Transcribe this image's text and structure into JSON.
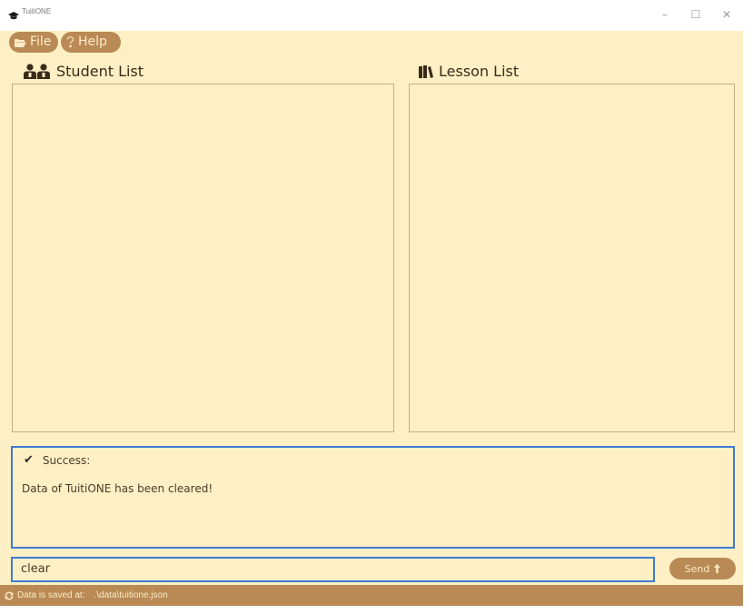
{
  "window": {
    "title": "TuitiONE",
    "controls": {
      "minimize": "–",
      "maximize": "☐",
      "close": "✕"
    }
  },
  "menu": {
    "file_label": "File",
    "help_label": "Help"
  },
  "panels": {
    "student_title": "Student List",
    "lesson_title": "Lesson List"
  },
  "result": {
    "status": "Success:",
    "message": "Data of TuitiONE has been cleared!"
  },
  "command": {
    "value": "clear",
    "send_label": "Send"
  },
  "status_bar": {
    "label": "Data is saved at:",
    "path": ".\\data\\tuitione.json"
  },
  "colors": {
    "background": "#fef0c4",
    "accent": "#b98a55",
    "focus_border": "#3d7bd4",
    "text": "#4a3a2a"
  },
  "icons": {
    "app": "graduation-cap-icon",
    "file": "folder-open-icon",
    "help": "question-icon",
    "students": "users-icon",
    "lessons": "books-icon",
    "success": "check-icon",
    "send": "arrow-up-icon",
    "sync": "sync-icon"
  }
}
